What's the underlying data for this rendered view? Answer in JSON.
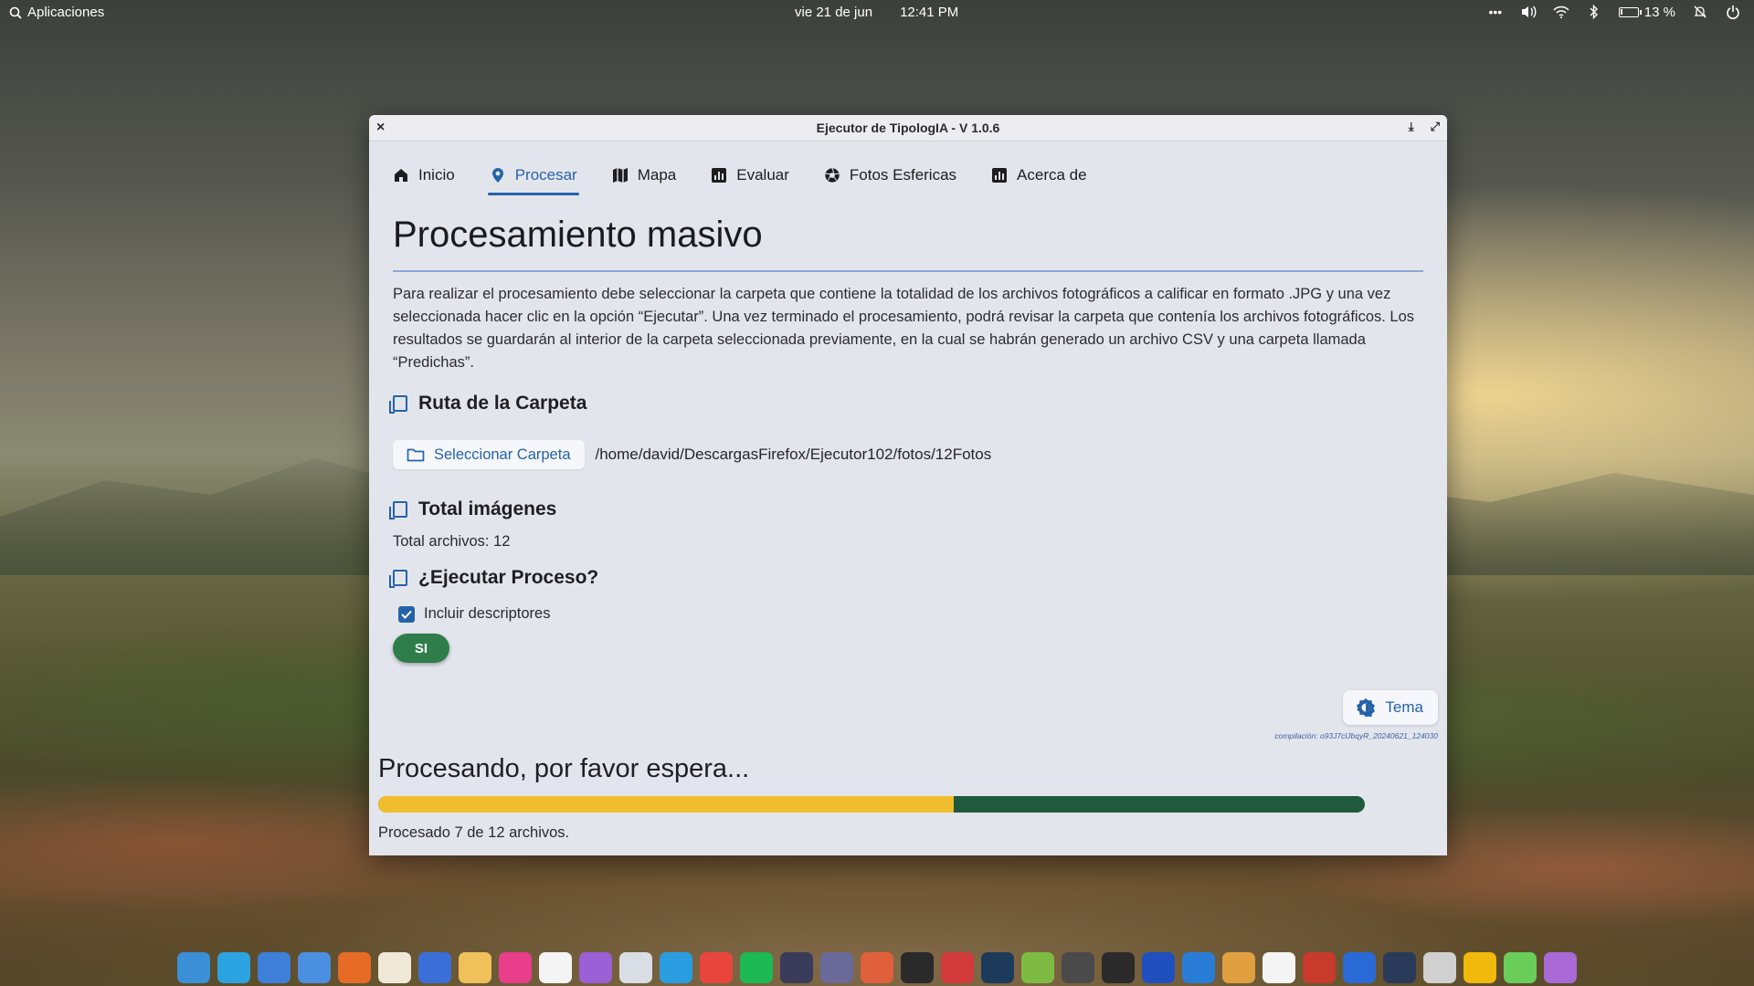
{
  "topbar": {
    "apps_label": "Aplicaciones",
    "date": "vie 21 de jun",
    "time": "12:41 PM",
    "battery_percent": "13 %",
    "battery_level": 0.13
  },
  "window": {
    "title": "Ejecutor de TipologIA - V 1.0.6",
    "close_glyph": "×",
    "minimize_glyph": "⤓",
    "maximize_glyph": "⤢"
  },
  "tabs": [
    {
      "label": "Inicio",
      "icon": "home-icon"
    },
    {
      "label": "Procesar",
      "icon": "process-icon",
      "active": true
    },
    {
      "label": "Mapa",
      "icon": "map-icon"
    },
    {
      "label": "Evaluar",
      "icon": "chart-icon"
    },
    {
      "label": "Fotos Esfericas",
      "icon": "aperture-icon"
    },
    {
      "label": "Acerca de",
      "icon": "info-chart-icon"
    }
  ],
  "page": {
    "title": "Procesamiento masivo",
    "description": "Para realizar el procesamiento debe seleccionar la carpeta que contiene la totalidad de los archivos fotográficos a calificar en formato .JPG y una vez seleccionada hacer clic en la opción “Ejecutar”. Una vez terminado el procesamiento, podrá revisar la carpeta que contenía los archivos fotográficos. Los resultados se guardarán al interior de la carpeta seleccionada previamente, en la cual se habrán generado un archivo CSV y una carpeta llamada “Predichas”."
  },
  "folder_section": {
    "heading": "Ruta de la Carpeta",
    "button_label": "Seleccionar Carpeta",
    "path": "/home/david/DescargasFirefox/Ejecutor102/fotos/12Fotos"
  },
  "images_section": {
    "heading": "Total imágenes",
    "total_text": "Total archivos: 12"
  },
  "run_section": {
    "heading": "¿Ejecutar Proceso?",
    "checkbox_label": "Incluir descriptores",
    "checkbox_checked": true,
    "run_button": "SI"
  },
  "theme_button": "Tema",
  "build_info": "compilación: o93J7clJbqyR_20240621_124030",
  "progress": {
    "title": "Procesando, por favor espera...",
    "processed": 7,
    "total": 12,
    "fraction": 0.583,
    "status_text": "Procesado 7 de 12 archivos.",
    "fill_color": "#f0be2c",
    "track_color": "#1e5a3b"
  },
  "colors": {
    "accent": "#2563a8",
    "run_button": "#2e7d4a"
  },
  "dock": [
    {
      "name": "files",
      "color": "#3b8fd6"
    },
    {
      "name": "telegram",
      "color": "#2aa3e0"
    },
    {
      "name": "finder-search",
      "color": "#3d7fd9"
    },
    {
      "name": "search",
      "color": "#4a8fe0"
    },
    {
      "name": "firefox",
      "color": "#e66b25"
    },
    {
      "name": "text-editor",
      "color": "#f0e9d8"
    },
    {
      "name": "writer",
      "color": "#3a6fd8"
    },
    {
      "name": "mail",
      "color": "#f0c05a"
    },
    {
      "name": "tasks",
      "color": "#e83e8c"
    },
    {
      "name": "calendar",
      "color": "#f4f4f4"
    },
    {
      "name": "photos",
      "color": "#9b5fd6"
    },
    {
      "name": "toggle",
      "color": "#d9dde4"
    },
    {
      "name": "sync",
      "color": "#2a9de0"
    },
    {
      "name": "chrome",
      "color": "#e8453c"
    },
    {
      "name": "spotify",
      "color": "#1db954"
    },
    {
      "name": "terminal-alt",
      "color": "#3a3a5a"
    },
    {
      "name": "settings",
      "color": "#6a6a9a"
    },
    {
      "name": "software",
      "color": "#e0603c"
    },
    {
      "name": "terminal",
      "color": "#2a2a2a"
    },
    {
      "name": "scissors",
      "color": "#d23a3a"
    },
    {
      "name": "monitor",
      "color": "#1e3a5a"
    },
    {
      "name": "qgis",
      "color": "#7dbb42"
    },
    {
      "name": "camera",
      "color": "#4a4a4a"
    },
    {
      "name": "inkscape",
      "color": "#2a2a2a"
    },
    {
      "name": "headphones",
      "color": "#2050c0"
    },
    {
      "name": "vscode",
      "color": "#2a7dd6"
    },
    {
      "name": "maps",
      "color": "#e0a040"
    },
    {
      "name": "ghostwriter",
      "color": "#f4f4f4"
    },
    {
      "name": "red-app",
      "color": "#c83a2a"
    },
    {
      "name": "window-manager",
      "color": "#2a6ad6"
    },
    {
      "name": "speedometer",
      "color": "#2a3a5a"
    },
    {
      "name": "screenshot",
      "color": "#d0d0d0"
    },
    {
      "name": "binance",
      "color": "#f0b90b"
    },
    {
      "name": "stairs",
      "color": "#6acd5a"
    },
    {
      "name": "star",
      "color": "#a86ad6"
    }
  ]
}
